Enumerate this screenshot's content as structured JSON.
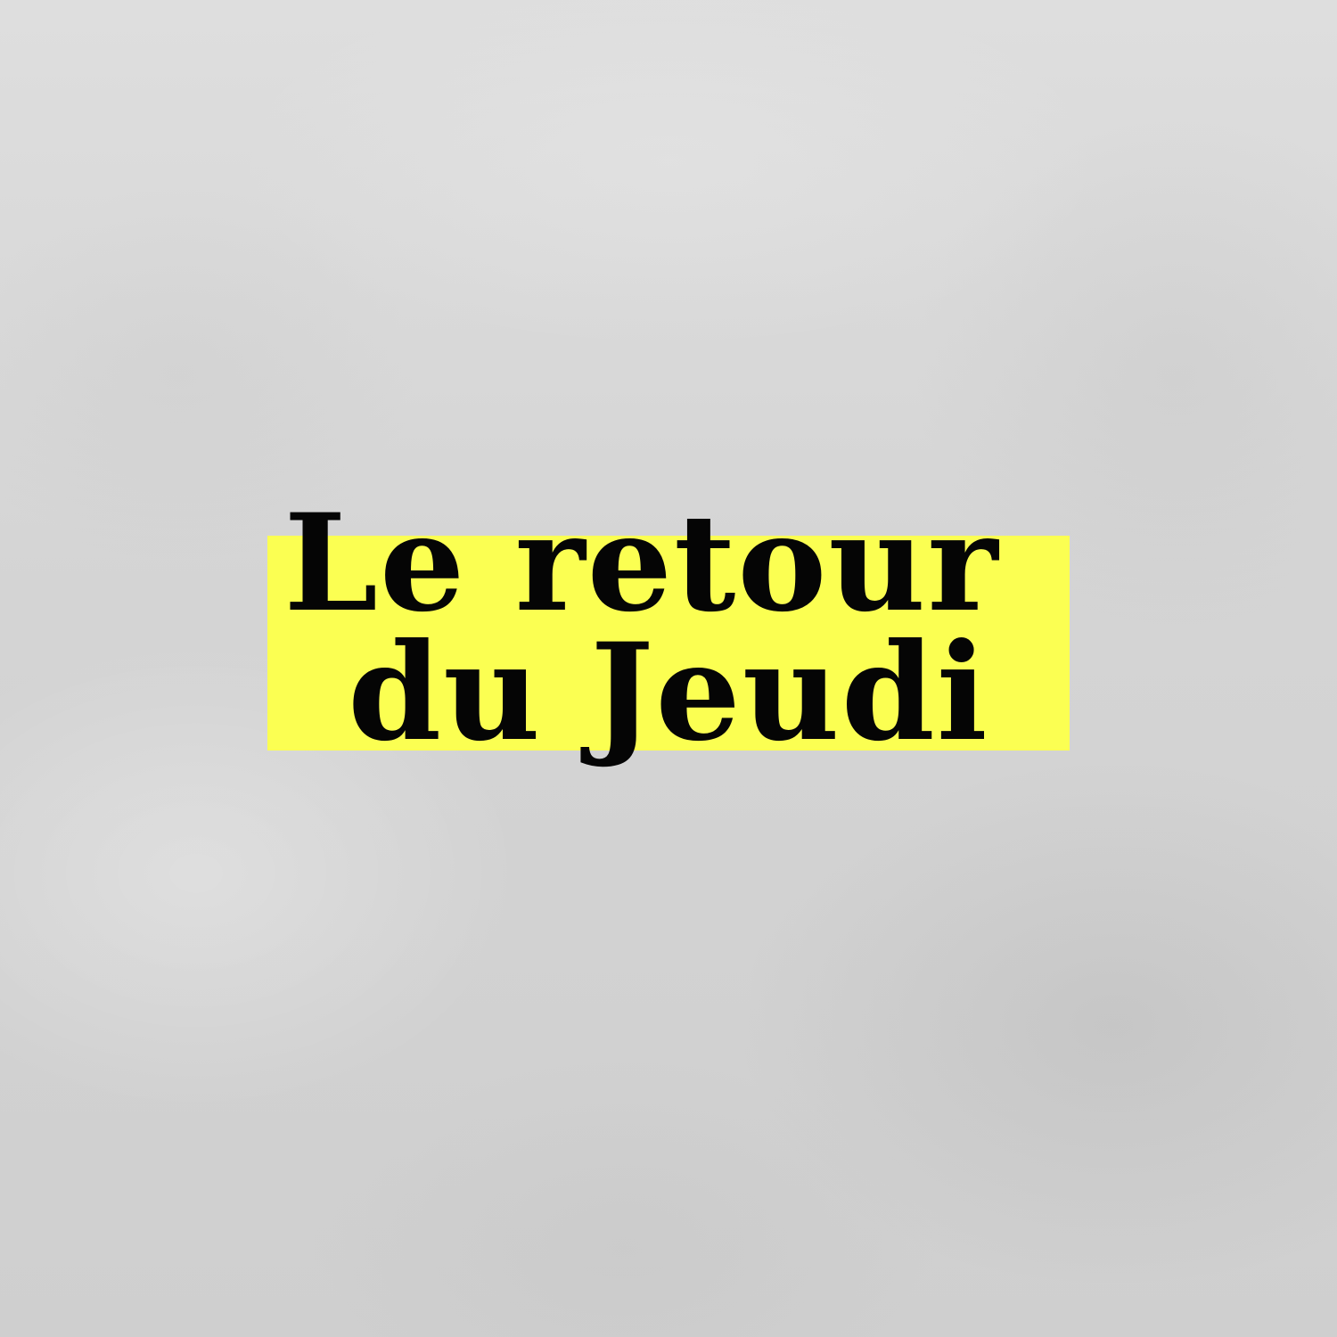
{
  "title": {
    "line1": "Le retour",
    "line2": "du Jeudi"
  },
  "colors": {
    "background": "#d6d6d6",
    "highlight": "#fbff52",
    "text": "#050505"
  }
}
